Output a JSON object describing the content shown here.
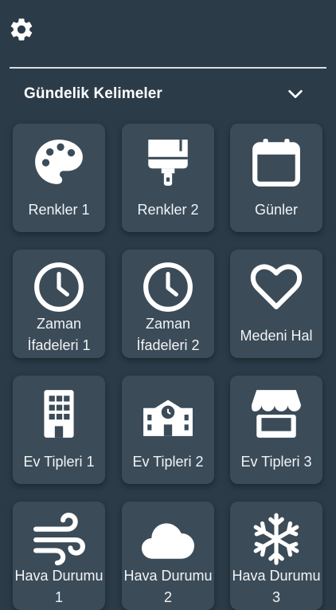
{
  "header": {
    "settings_icon": "gear-icon"
  },
  "section": {
    "title": "Gündelik Kelimeler",
    "toggle_icon": "chevron-down-icon"
  },
  "cards": [
    {
      "label": "Renkler 1",
      "icon": "palette-icon"
    },
    {
      "label": "Renkler 2",
      "icon": "paintbrush-icon"
    },
    {
      "label": "Günler",
      "icon": "calendar-icon"
    },
    {
      "label": "Zaman\nİfadeleri 1",
      "icon": "clock-icon"
    },
    {
      "label": "Zaman\nİfadeleri 2",
      "icon": "clock-icon"
    },
    {
      "label": "Medeni Hal",
      "icon": "heart-icon"
    },
    {
      "label": "Ev Tipleri 1",
      "icon": "building-icon"
    },
    {
      "label": "Ev Tipleri 2",
      "icon": "school-icon"
    },
    {
      "label": "Ev Tipleri 3",
      "icon": "store-icon"
    },
    {
      "label": "Hava Durumu\n1",
      "icon": "wind-icon"
    },
    {
      "label": "Hava Durumu\n2",
      "icon": "cloud-icon"
    },
    {
      "label": "Hava Durumu\n3",
      "icon": "snowflake-icon"
    }
  ],
  "colors": {
    "background": "#2b3b48",
    "card": "#3b4b58",
    "text": "#ffffff"
  }
}
